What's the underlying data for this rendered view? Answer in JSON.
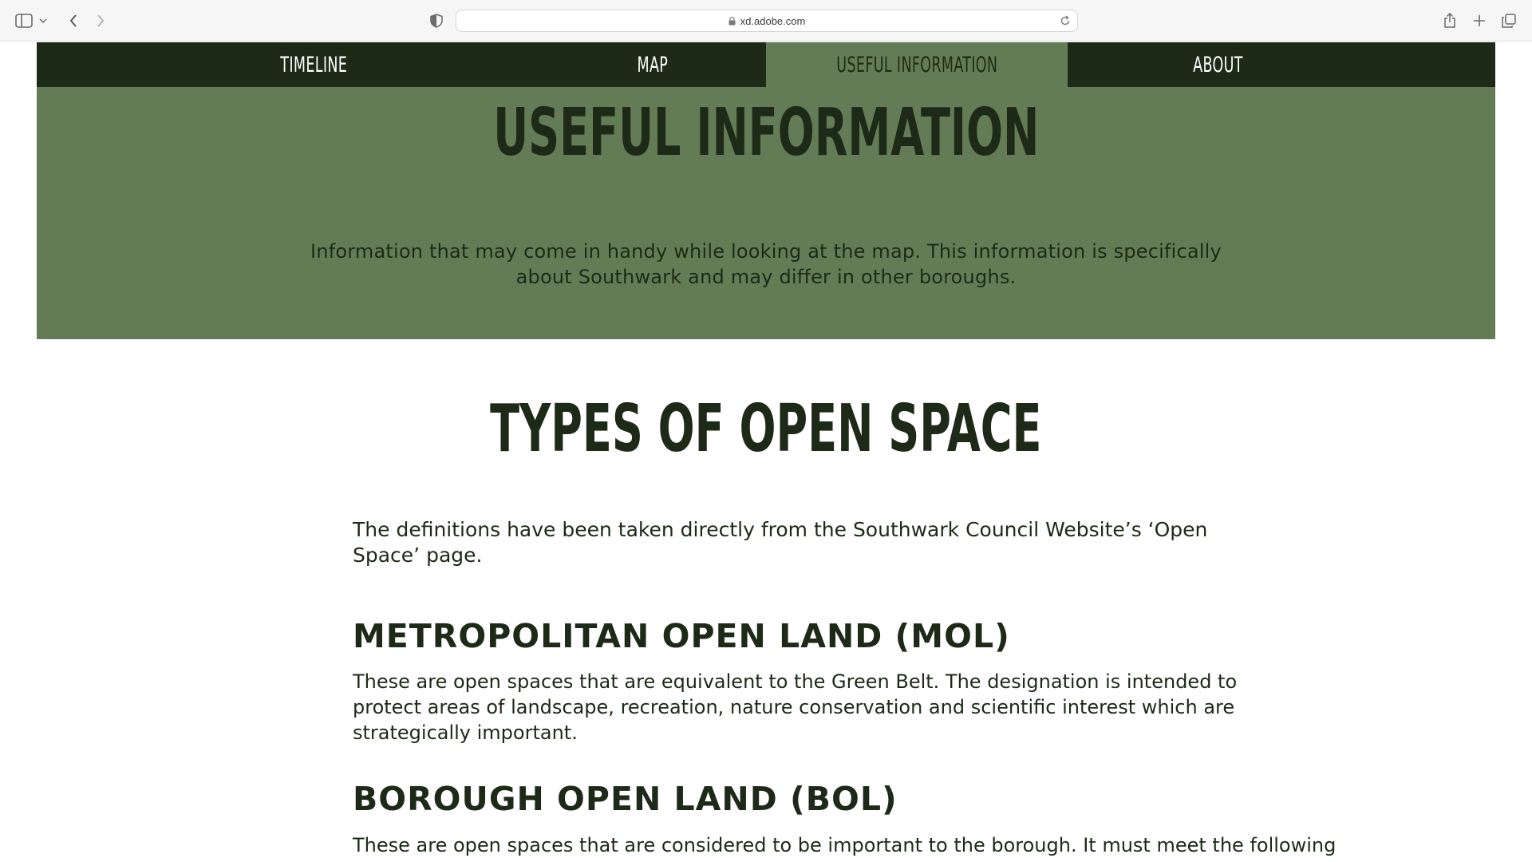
{
  "browser": {
    "url": "xd.adobe.com"
  },
  "nav": {
    "items": [
      {
        "label": "TIMELINE",
        "active": false
      },
      {
        "label": "MAP",
        "active": false
      },
      {
        "label": "USEFUL INFORMATION",
        "active": true
      },
      {
        "label": "ABOUT",
        "active": false
      }
    ]
  },
  "hero": {
    "title": "USEFUL INFORMATION",
    "description": "Information that may come in handy while looking at the map. This information is specifically about Southwark and may differ in other boroughs."
  },
  "main": {
    "title": "TYPES OF OPEN SPACE",
    "intro": "The definitions have been taken directly from the Southwark Council Website’s ‘Open Space’ page.",
    "definitions": [
      {
        "heading": "METROPOLITAN OPEN LAND (MOL)",
        "body": "These are open spaces that are equivalent to the Green Belt. The designation is intended to protect areas of landscape, recreation, nature conservation and scientific interest which are strategically important."
      },
      {
        "heading": "BOROUGH OPEN LAND (BOL)",
        "body": "These are open spaces that are considered to be important to the borough. It must meet the following"
      }
    ]
  },
  "colors": {
    "dark_green": "#1c2a17",
    "mid_green": "#647c55",
    "background": "#ffffff"
  }
}
